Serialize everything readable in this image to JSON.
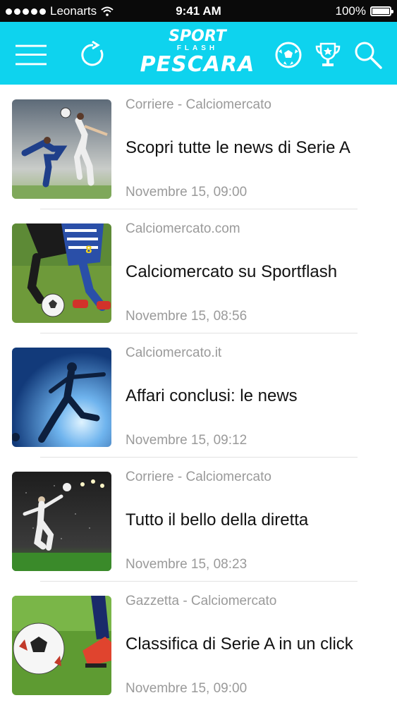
{
  "status_bar": {
    "carrier": "Leonarts",
    "time": "9:41 AM",
    "battery": "100%"
  },
  "nav": {
    "menu_icon": "hamburger-icon",
    "refresh_icon": "refresh-icon",
    "ball_icon": "soccer-ball-icon",
    "trophy_icon": "trophy-icon",
    "search_icon": "search-icon",
    "logo": {
      "line1": "SPORT",
      "line2": "FLASH",
      "line3": "PESCARA"
    }
  },
  "colors": {
    "accent": "#0ed3ee",
    "muted_text": "#9a9a9a"
  },
  "news": [
    {
      "source": "Corriere - Calciomercato",
      "title": "Scopri tutte le news di Serie A",
      "time": "Novembre 15, 09:00"
    },
    {
      "source": "Calciomercato.com",
      "title": "Calciomercato su Sportflash",
      "time": "Novembre 15, 08:56"
    },
    {
      "source": "Calciomercato.it",
      "title": "Affari conclusi: le news",
      "time": "Novembre 15, 09:12"
    },
    {
      "source": "Corriere - Calciomercato",
      "title": "Tutto il bello della diretta",
      "time": "Novembre 15, 08:23"
    },
    {
      "source": "Gazzetta - Calciomercato",
      "title": "Classifica di Serie A in un click",
      "time": "Novembre 15, 09:00"
    }
  ]
}
